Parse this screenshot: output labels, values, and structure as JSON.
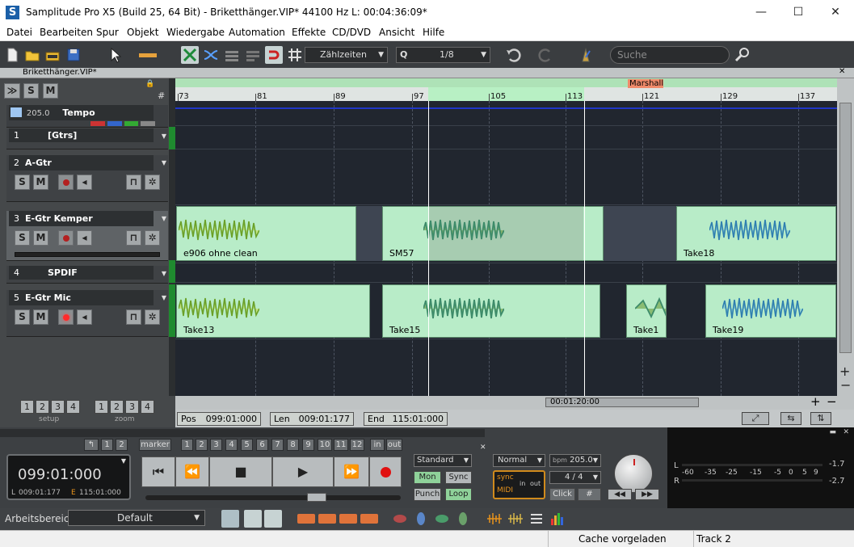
{
  "window": {
    "app_icon": "S",
    "title": "Samplitude Pro X5 (Build 25, 64 Bit)  -  Briketthänger.VIP*   44100 Hz L: 00:04:36:09*",
    "minimize": "—",
    "maximize": "☐",
    "close": "✕"
  },
  "menu": [
    "Datei",
    "Bearbeiten",
    "Spur",
    "Objekt",
    "Wiedergabe",
    "Automation",
    "Effekte",
    "CD/DVD",
    "Ansicht",
    "Hilfe"
  ],
  "toolbar": {
    "timebase": "Zählzeiten",
    "quantize_icon": "Q",
    "quantize": "1/8",
    "search_placeholder": "Suche"
  },
  "doc": {
    "tab": "Briketthänger.VIP*"
  },
  "header_controls": {
    "expand": "≫",
    "solo": "S",
    "mute": "M",
    "grid": "#"
  },
  "tempo": {
    "value": "205.0",
    "label": "Tempo"
  },
  "tracks": [
    {
      "num": "1",
      "name": "[Gtrs]",
      "type": "folder"
    },
    {
      "num": "2",
      "name": "A-Gtr",
      "type": "audio"
    },
    {
      "num": "3",
      "name": "E-Gtr Kemper",
      "type": "audio",
      "selected": true
    },
    {
      "num": "4",
      "name": "SPDIF",
      "type": "folder"
    },
    {
      "num": "5",
      "name": "E-Gtr Mic",
      "type": "audio",
      "armed": true
    }
  ],
  "track_buttons": {
    "s": "S",
    "m": "M"
  },
  "setup": {
    "label": "setup",
    "zoom_label": "zoom",
    "buttons": [
      "1",
      "2",
      "3",
      "4"
    ]
  },
  "ruler": {
    "ticks": [
      "73",
      "81",
      "89",
      "97",
      "105",
      "113",
      "121",
      "129",
      "137"
    ],
    "marker": "Marshall"
  },
  "objects": {
    "row3": [
      {
        "label": "e906 ohne clean"
      },
      {
        "label": "SM57"
      },
      {
        "label": "Take18"
      }
    ],
    "row5": [
      {
        "label": "Take13"
      },
      {
        "label": "Take15"
      },
      {
        "label": "Take1"
      },
      {
        "label": "Take19"
      }
    ]
  },
  "scroll": {
    "time": "00:01:20:00",
    "plus": "+",
    "minus": "−"
  },
  "position": {
    "pos_label": "Pos",
    "pos": "099:01:000",
    "len_label": "Len",
    "len": "009:01:177",
    "end_label": "End",
    "end": "115:01:000"
  },
  "transport": {
    "marker_label": "marker",
    "marker_buttons": [
      "1",
      "2",
      "3",
      "4",
      "5",
      "6",
      "7",
      "8",
      "9",
      "10",
      "11",
      "12"
    ],
    "in": "in",
    "out": "out",
    "time": "099:01:000",
    "l_label": "L",
    "l_time": "009:01:177",
    "e_label": "E",
    "e_time": "115:01:000",
    "standard": "Standard",
    "mon": "Mon",
    "sync_btn": "Sync",
    "punch": "Punch",
    "loop": "Loop",
    "mode": "Normal",
    "bpm_label": "bpm",
    "bpm": "205.0",
    "meter": "4 / 4",
    "click": "Click",
    "sync": "sync",
    "midi": "MIDI",
    "in2": "in",
    "out2": "out"
  },
  "meters": {
    "l": "L",
    "r": "R",
    "scale": [
      "-60",
      "-35",
      "-25",
      "-15",
      "-5",
      "0",
      "5",
      "9"
    ],
    "peak_l": "-1.7",
    "peak_r": "-2.7"
  },
  "bottom": {
    "workspace_label": "Arbeitsbereich:",
    "workspace": "Default"
  },
  "status": {
    "cache": "Cache vorgeladen",
    "track": "Track 2"
  }
}
